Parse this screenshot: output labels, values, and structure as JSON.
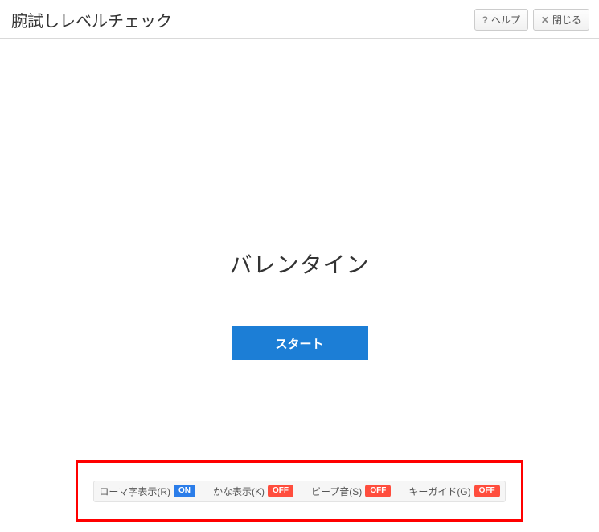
{
  "header": {
    "title": "腕試しレベルチェック",
    "help_label": "ヘルプ",
    "close_label": "閉じる"
  },
  "main": {
    "prompt_word": "バレンタイン",
    "start_label": "スタート"
  },
  "options": [
    {
      "label": "ローマ字表示(R)",
      "state": "ON",
      "state_class": "on"
    },
    {
      "label": "かな表示(K)",
      "state": "OFF",
      "state_class": "off"
    },
    {
      "label": "ビープ音(S)",
      "state": "OFF",
      "state_class": "off"
    },
    {
      "label": "キーガイド(G)",
      "state": "OFF",
      "state_class": "off"
    }
  ]
}
